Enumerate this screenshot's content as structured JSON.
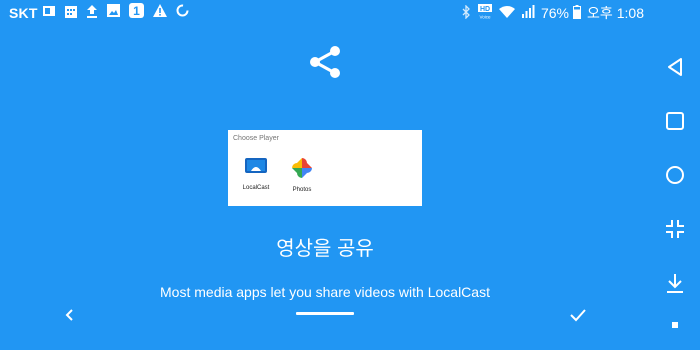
{
  "status_bar": {
    "carrier": "SKT",
    "battery_percent": "76%",
    "ampm": "오후",
    "time": "1:08",
    "notification_badge": "1",
    "hd_badge_top": "HD",
    "hd_badge_bottom": "Voice",
    "icons_left": [
      "sim-card-icon",
      "calendar-icon",
      "upload-icon",
      "image-icon",
      "number-one-badge-icon",
      "warning-icon",
      "sync-icon"
    ],
    "icons_right": [
      "bluetooth-icon",
      "hd-voice-icon",
      "wifi-icon",
      "signal-icon",
      "battery-icon"
    ]
  },
  "slide": {
    "icon": "share-icon",
    "dialog": {
      "title": "Choose Player",
      "apps": [
        {
          "label": "LocalCast",
          "icon": "localcast-icon"
        },
        {
          "label": "Photos",
          "icon": "google-photos-icon"
        }
      ]
    },
    "title": "영상을 공유",
    "description": "Most media apps let you share videos with LocalCast"
  },
  "onboarding_nav": {
    "prev_icon": "chevron-left-icon",
    "done_icon": "checkmark-icon"
  },
  "system_nav": {
    "items": [
      "back-triangle-icon",
      "recents-square-icon",
      "home-circle-icon",
      "exit-fullscreen-icon",
      "notification-down-icon",
      "small-square-icon"
    ]
  },
  "colors": {
    "background": "#2196F3",
    "foreground": "#FFFFFF",
    "dialog_background": "#FFFFFF"
  }
}
